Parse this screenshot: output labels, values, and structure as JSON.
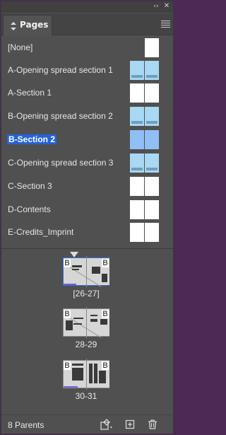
{
  "window": {
    "collapse_glyph": "‹‹",
    "close_glyph": "✕"
  },
  "panel": {
    "tab_label": "Pages",
    "tab_icon": "updown-arrows-icon",
    "menu_icon": "panel-menu-icon"
  },
  "parents": [
    {
      "label": "[None]",
      "thumb": "single-white"
    },
    {
      "label": "A-Opening spread section 1",
      "thumb": "spread-blue"
    },
    {
      "label": "A-Section 1",
      "thumb": "spread-white"
    },
    {
      "label": "B-Opening spread section 2",
      "thumb": "spread-blue"
    },
    {
      "label": "B-Section 2",
      "thumb": "spread-blue-selected",
      "selected": true
    },
    {
      "label": "C-Opening spread section 3",
      "thumb": "spread-blue"
    },
    {
      "label": "C-Section 3",
      "thumb": "spread-white"
    },
    {
      "label": "D-Contents",
      "thumb": "spread-white"
    },
    {
      "label": "E-Credits_Imprint",
      "thumb": "spread-white"
    }
  ],
  "spreads": [
    {
      "label": "[26-27]",
      "parent_prefix_left": "B",
      "parent_prefix_right": "B",
      "selected": true
    },
    {
      "label": "28-29",
      "parent_prefix_left": "B",
      "parent_prefix_right": "B"
    },
    {
      "label": "30-31",
      "parent_prefix_left": "B",
      "parent_prefix_right": "B"
    }
  ],
  "status": {
    "parents_count": "8 Parents"
  },
  "toolbar": {
    "icons": [
      "edit-page-size-icon",
      "new-page-icon",
      "delete-page-icon"
    ]
  },
  "colors": {
    "selection": "#2563d6",
    "panel_bg": "#505050",
    "thumb_blue": "#a8d8f2"
  }
}
